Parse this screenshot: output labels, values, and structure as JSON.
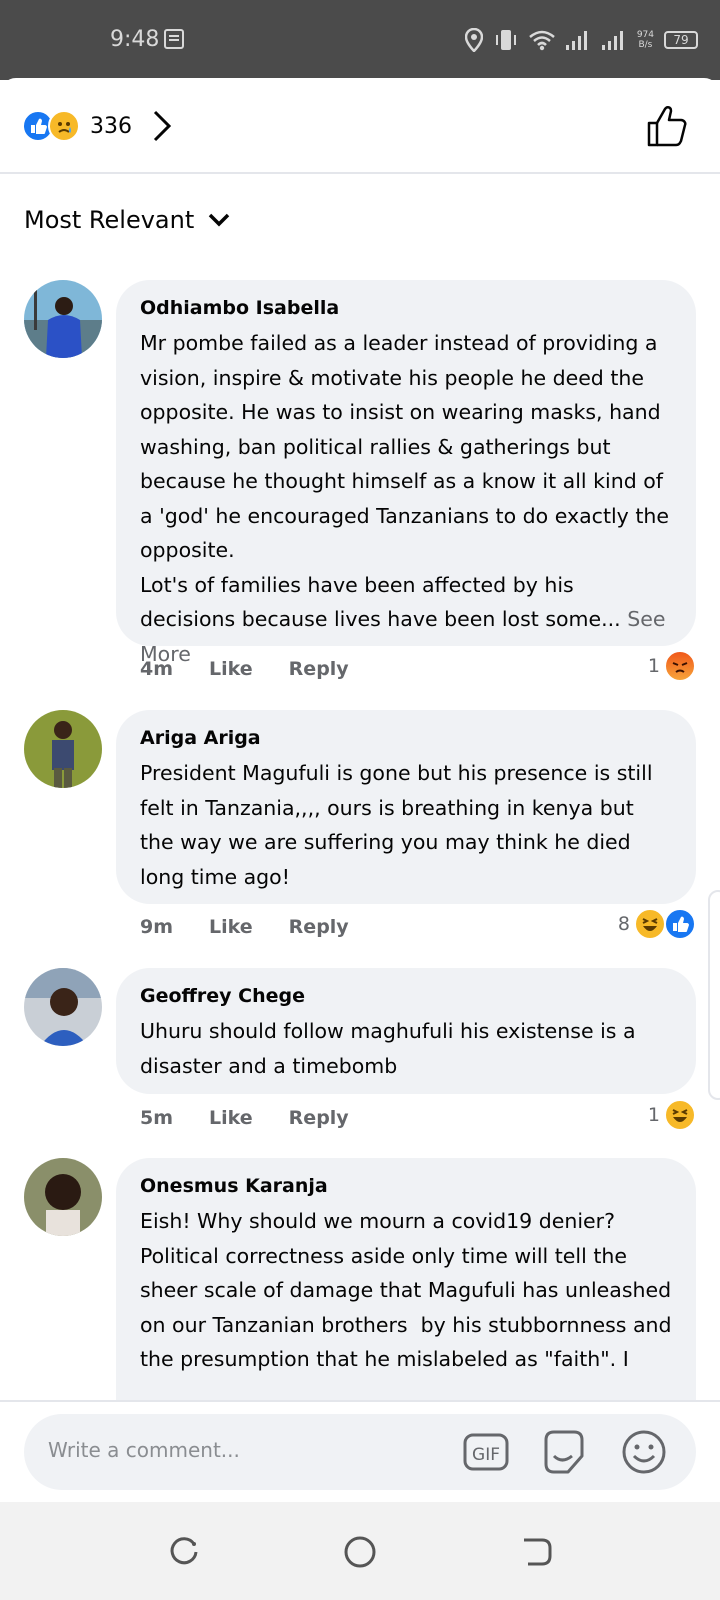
{
  "status": {
    "time": "9:48",
    "net_speed_value": "974",
    "net_speed_unit": "B/s",
    "battery": "79"
  },
  "header": {
    "reaction_count": "336"
  },
  "sort": {
    "label": "Most Relevant"
  },
  "comments": [
    {
      "author": "Odhiambo Isabella",
      "text": "Mr pombe failed as a leader instead of providing a vision, inspire & motivate his people he deed the opposite. He was to insist on wearing masks, hand washing, ban political rallies & gatherings but because he thought himself as a know it all kind of a 'god' he encouraged Tanzanians to do exactly the opposite.\nLot's of families have been affected by his decisions because lives have been lost some...",
      "see_more": "See More",
      "time": "4m",
      "like": "Like",
      "reply": "Reply",
      "reaction_count": "1",
      "reactions": [
        "angry"
      ]
    },
    {
      "author": "Ariga Ariga",
      "text": "President Magufuli is gone but his presence is still felt in Tanzania,,,, ours is breathing in kenya but the way we are suffering you may think he died long time ago!",
      "time": "9m",
      "like": "Like",
      "reply": "Reply",
      "reaction_count": "8",
      "reactions": [
        "haha",
        "like"
      ]
    },
    {
      "author": "Geoffrey Chege",
      "text": "Uhuru should follow maghufuli his existense is a disaster and a timebomb",
      "time": "5m",
      "like": "Like",
      "reply": "Reply",
      "reaction_count": "1",
      "reactions": [
        "haha"
      ]
    },
    {
      "author": "Onesmus Karanja",
      "text": "Eish! Why should we mourn a covid19 denier? Political correctness aside only time will tell the sheer scale of damage that Magufuli has unleashed on our Tanzanian brothers  by his stubbornness and the presumption that he mislabeled as \"faith\". I"
    }
  ],
  "composer": {
    "placeholder": "Write a comment..."
  },
  "colors": {
    "accent": "#1877f2",
    "bubble": "#f0f2f5",
    "meta_text": "#65676b"
  }
}
